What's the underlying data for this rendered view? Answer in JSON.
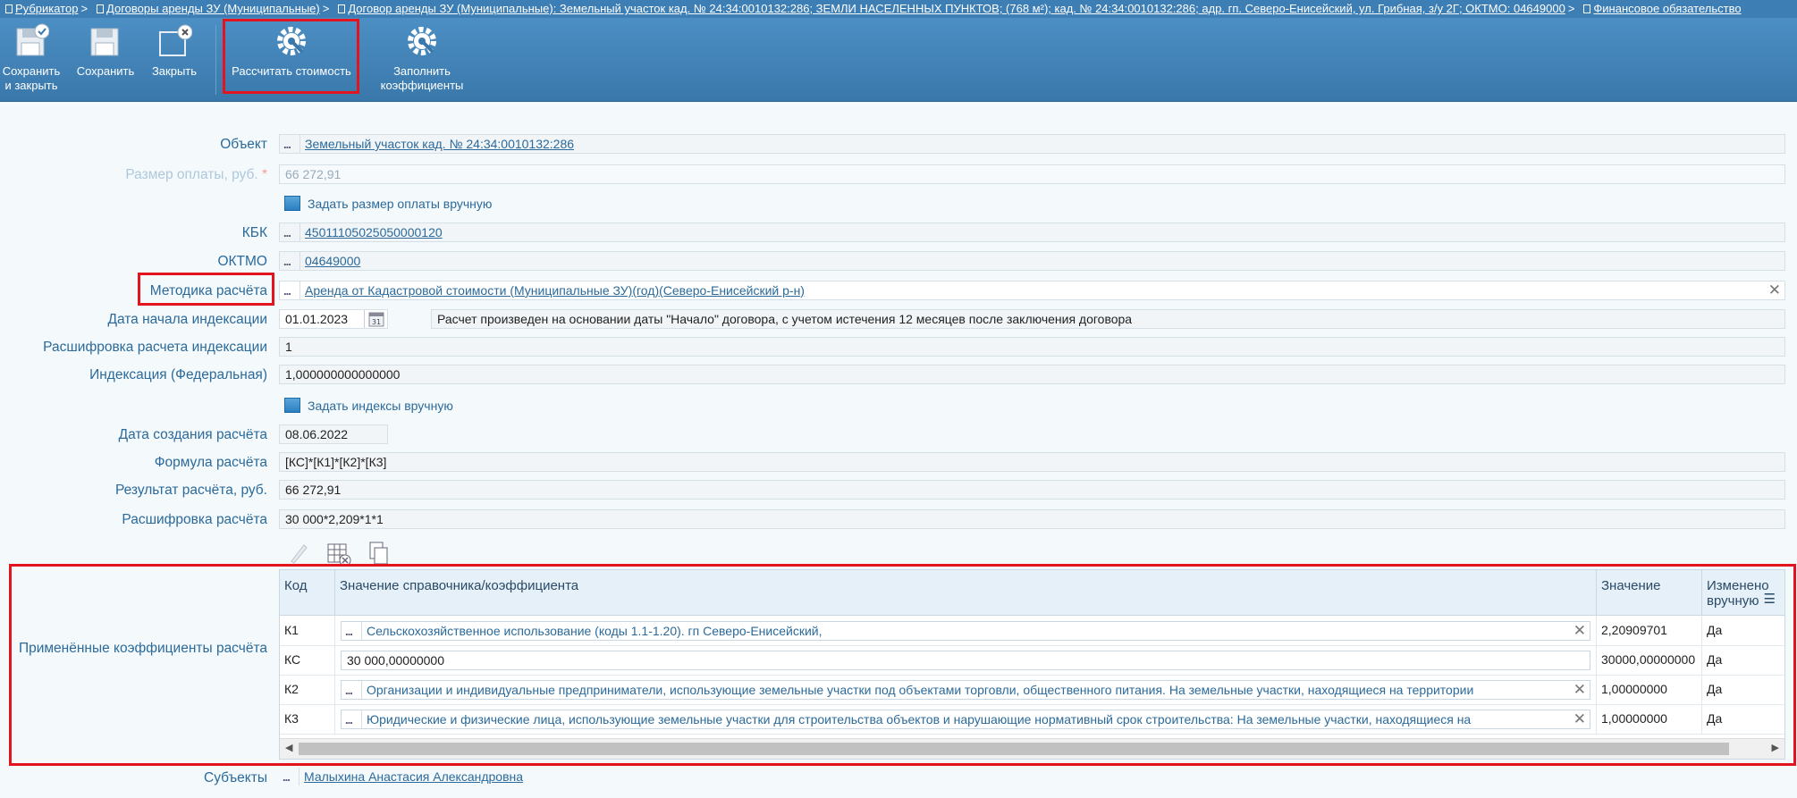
{
  "breadcrumb": [
    {
      "label": "Рубрикатор",
      "icon": "folder-icon"
    },
    {
      "label": "Договоры аренды ЗУ (Муниципальные)",
      "icon": "list-icon"
    },
    {
      "label": "Договор аренды ЗУ (Муниципальные): Земельный участок кад. № 24:34:0010132:286; ЗЕМЛИ НАСЕЛЕННЫХ ПУНКТОВ; (768 м²); кад. № 24:34:0010132:286; адр. гп. Северо-Енисейский, ул. Грибная, з/у 2Г; ОКТМО: 04649000",
      "icon": "document-icon"
    },
    {
      "label": "Финансовое обязательство",
      "icon": "document-icon"
    }
  ],
  "breadcrumb_sep": ">",
  "toolbar": {
    "save_close": [
      "Сохранить",
      "и закрыть"
    ],
    "save": "Сохранить",
    "close": "Закрыть",
    "calc_cost": "Рассчитать стоимость",
    "fill_coeffs": [
      "Заполнить",
      "коэффициенты"
    ]
  },
  "form": {
    "object_label": "Объект",
    "object_value": "Земельный участок кад. № 24:34:0010132:286",
    "payment_label": "Размер оплаты, руб.",
    "payment_required": "*",
    "payment_value": "66 272,91",
    "manual_payment_label": "Задать размер оплаты вручную",
    "kbk_label": "КБК",
    "kbk_value": "45011105025050000120",
    "oktmo_label": "ОКТМО",
    "oktmo_value": "04649000",
    "method_label": "Методика расчёта",
    "method_value": "Аренда от Кадастровой стоимости (Муниципальные ЗУ)(год)(Северо-Енисейский р-н)",
    "index_start_label": "Дата начала индексации",
    "index_start_value": "01.01.2023",
    "calendar_day": "31",
    "index_start_note": "Расчет произведен на основании даты \"Начало\" договора, с учетом истечения 12 месяцев после заключения договора",
    "index_decode_label": "Расшифровка расчета индексации",
    "index_decode_value": "1",
    "federal_index_label": "Индексация (Федеральная)",
    "federal_index_value": "1,000000000000000",
    "manual_index_label": "Задать индексы вручную",
    "calc_date_label": "Дата создания расчёта",
    "calc_date_value": "08.06.2022",
    "formula_label": "Формула расчёта",
    "formula_value": "[КС]*[К1]*[К2]*[К3]",
    "result_label": "Результат расчёта, руб.",
    "result_value": "66 272,91",
    "decode_label": "Расшифровка расчёта",
    "decode_value": "30 000*2,209*1*1",
    "coeffs_label": "Применённые коэффициенты расчёта",
    "subjects_label": "Субъекты",
    "subjects_value": "Малыхина Анастасия Александровна"
  },
  "grid": {
    "columns": [
      "Код",
      "Значение справочника/коэффициента",
      "Значение",
      [
        "Изменено",
        "вручную"
      ]
    ],
    "rows": [
      {
        "code": "К1",
        "ref": "Сельскохозяйственное использование (коды 1.1-1.20). гп Северо-Енисейский,",
        "value": "2,20909701",
        "manual": "Да",
        "lookup": true
      },
      {
        "code": "КС",
        "ref": "30 000,00000000",
        "value": "30000,00000000",
        "manual": "Да",
        "lookup": false
      },
      {
        "code": "К2",
        "ref": "Организации и индивидуальные предприниматели, использующие земельные участки под объектами торговли, общественного питания. На земельные участки, находящиеся на территории",
        "value": "1,00000000",
        "manual": "Да",
        "lookup": true
      },
      {
        "code": "К3",
        "ref": "Юридические и физические лица, использующие земельные участки для строительства объектов и нарушающие нормативный срок строительства: На земельные участки, находящиеся на",
        "value": "1,00000000",
        "manual": "Да",
        "lookup": true
      }
    ]
  },
  "colors": {
    "accent": "#3d7eb5",
    "highlight": "#e3141e",
    "label": "#2b6a9a"
  }
}
